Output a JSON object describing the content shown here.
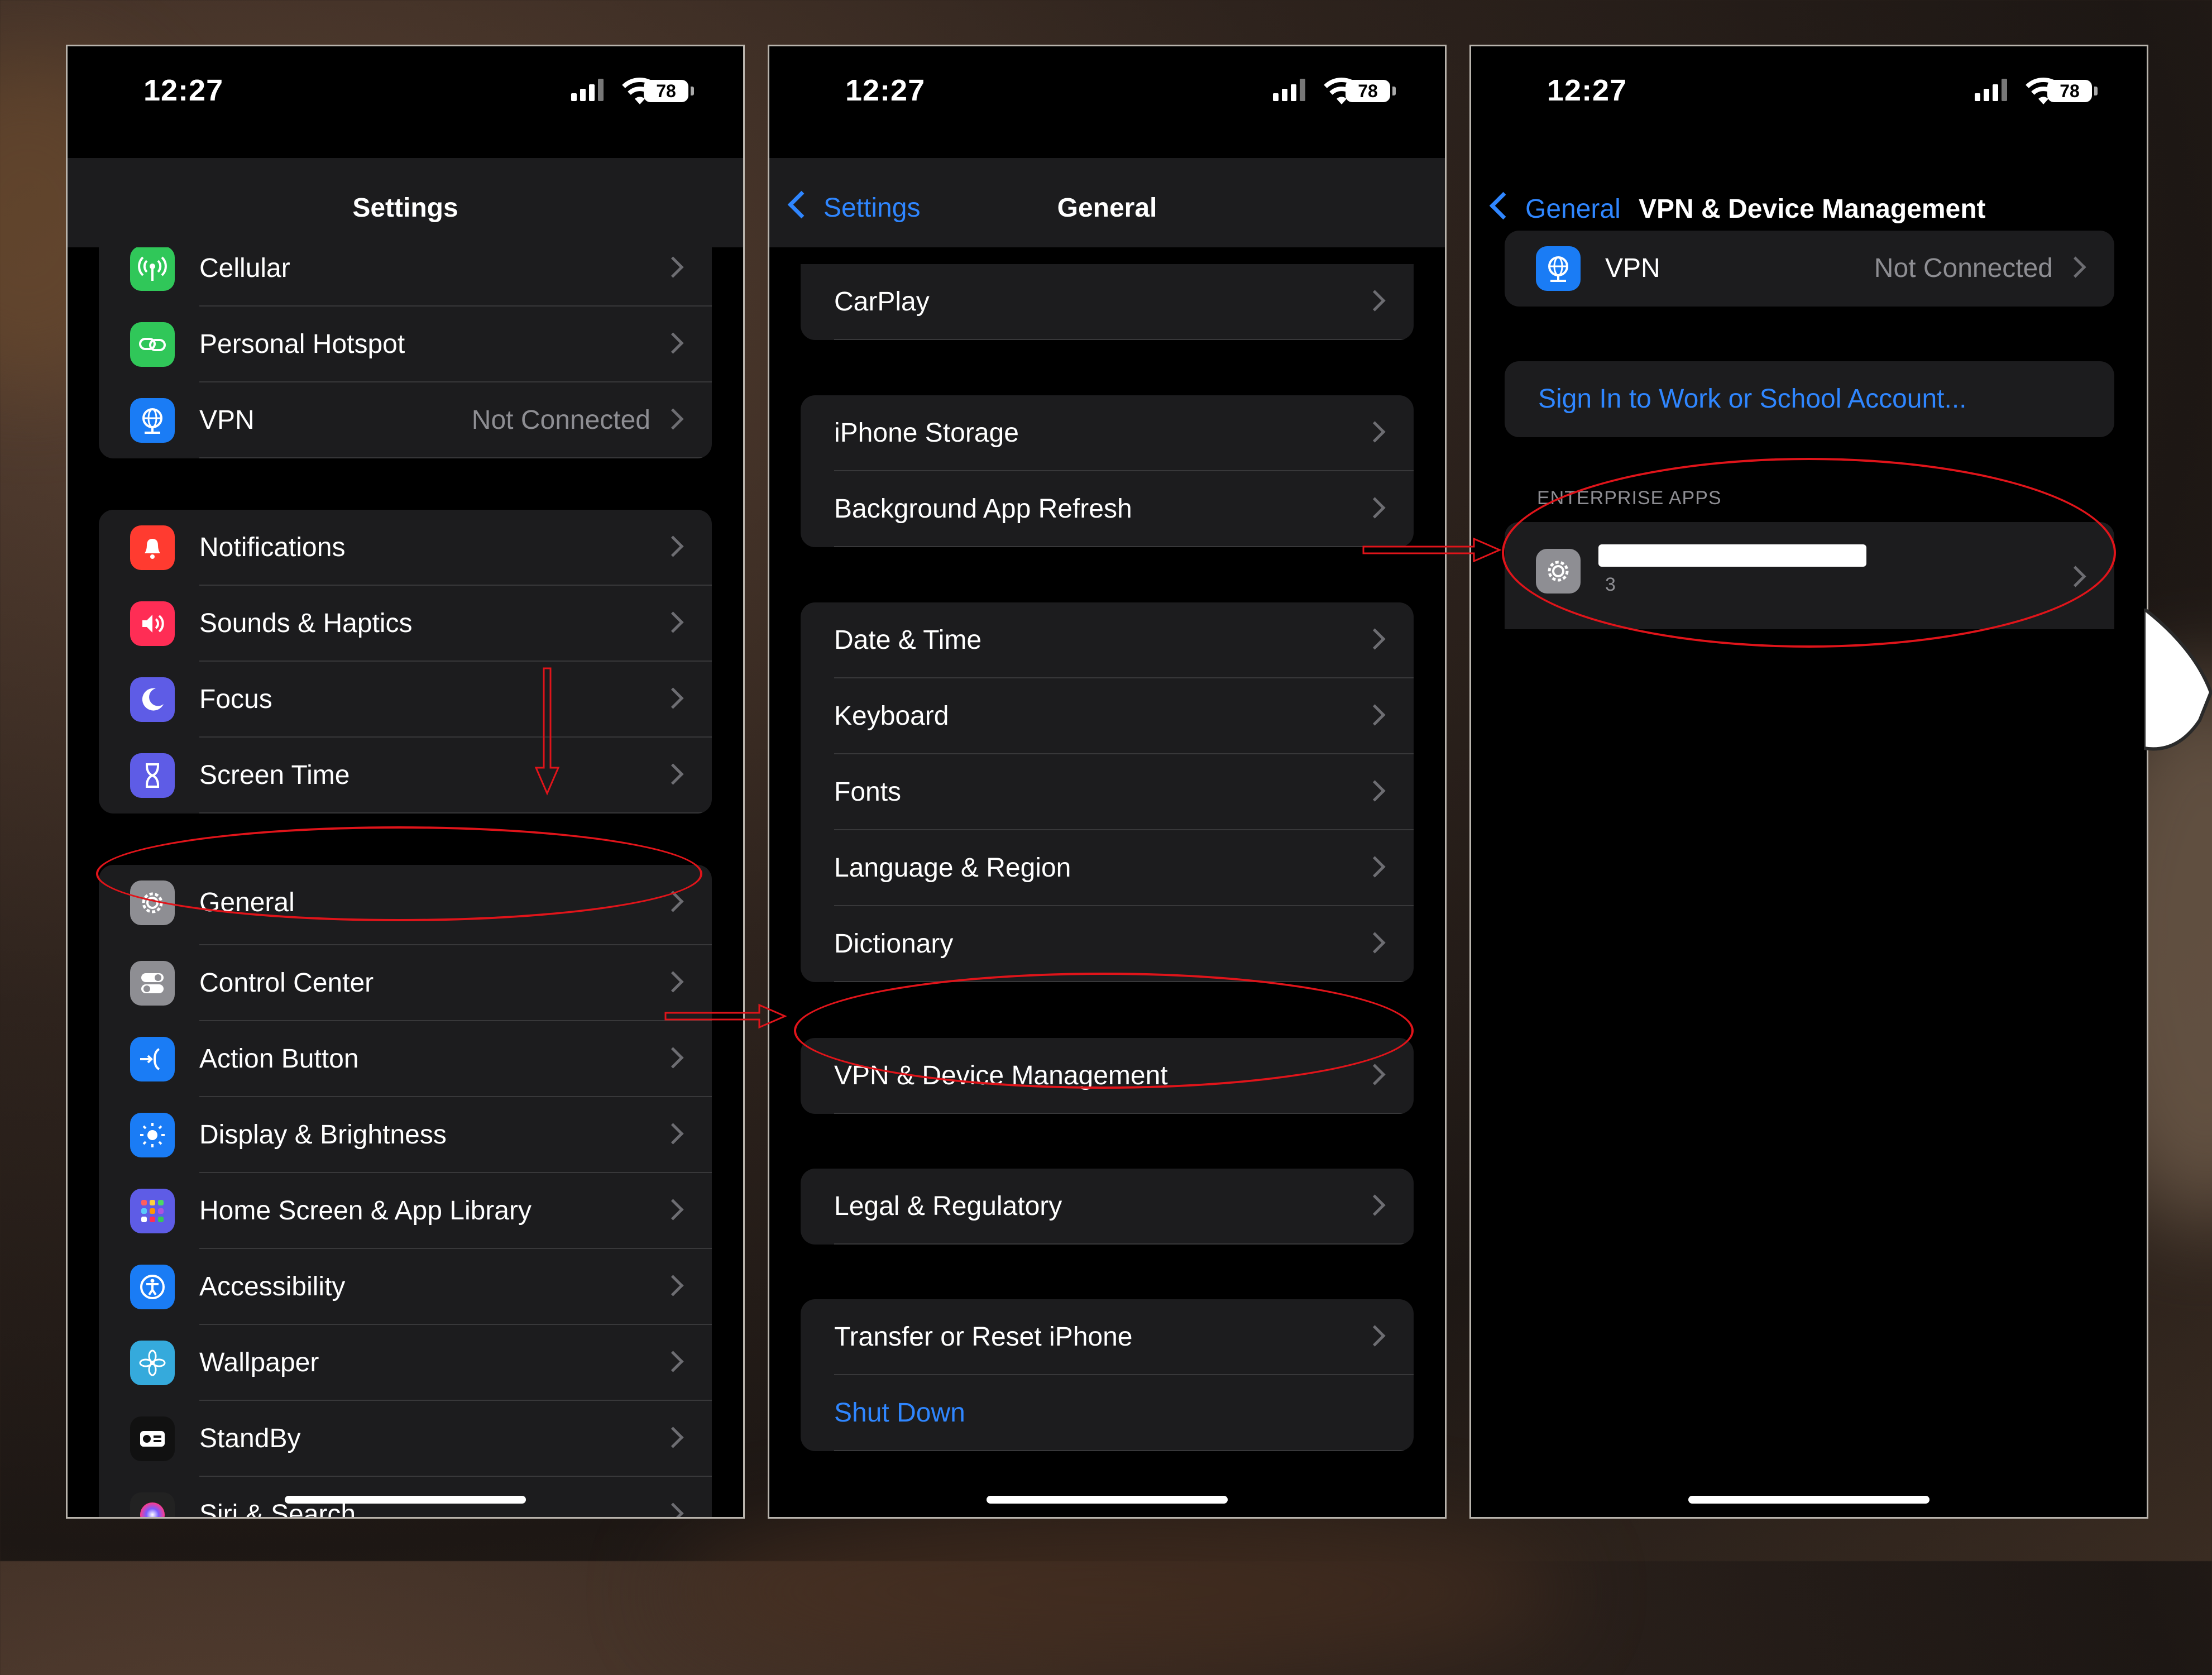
{
  "status": {
    "time": "12:27",
    "battery": "78"
  },
  "screen1": {
    "title": "Settings",
    "groups": [
      [
        {
          "label": "Cellular",
          "icon": "antenna-icon",
          "color": "#30c759"
        },
        {
          "label": "Personal Hotspot",
          "icon": "link-icon",
          "color": "#30c759"
        },
        {
          "label": "VPN",
          "icon": "globe-icon",
          "color": "#1a7cf5",
          "value": "Not Connected"
        }
      ],
      [
        {
          "label": "Notifications",
          "icon": "bell-icon",
          "color": "#ff3b30"
        },
        {
          "label": "Sounds & Haptics",
          "icon": "speaker-icon",
          "color": "#ff2d55"
        },
        {
          "label": "Focus",
          "icon": "moon-icon",
          "color": "#5e5ce6"
        },
        {
          "label": "Screen Time",
          "icon": "hourglass-icon",
          "color": "#5e5ce6"
        }
      ],
      [
        {
          "label": "General",
          "icon": "gear-icon",
          "color": "#8e8e93"
        },
        {
          "label": "Control Center",
          "icon": "toggles-icon",
          "color": "#8e8e93"
        },
        {
          "label": "Action Button",
          "icon": "action-icon",
          "color": "#1a7cf5"
        },
        {
          "label": "Display & Brightness",
          "icon": "sun-icon",
          "color": "#1a7cf5"
        },
        {
          "label": "Home Screen & App Library",
          "icon": "grid-icon",
          "color": "#5e5ce6"
        },
        {
          "label": "Accessibility",
          "icon": "accessibility-icon",
          "color": "#1a7cf5"
        },
        {
          "label": "Wallpaper",
          "icon": "flower-icon",
          "color": "#35aadc"
        },
        {
          "label": "StandBy",
          "icon": "standby-icon",
          "color": "#111111"
        },
        {
          "label": "Siri & Search",
          "icon": "siri-icon",
          "color": "#222222"
        }
      ]
    ]
  },
  "screen2": {
    "back": "Settings",
    "title": "General",
    "groups": [
      [
        {
          "label": "CarPlay"
        }
      ],
      [
        {
          "label": "iPhone Storage"
        },
        {
          "label": "Background App Refresh"
        }
      ],
      [
        {
          "label": "Date & Time"
        },
        {
          "label": "Keyboard"
        },
        {
          "label": "Fonts"
        },
        {
          "label": "Language & Region"
        },
        {
          "label": "Dictionary"
        }
      ],
      [
        {
          "label": "VPN & Device Management"
        }
      ],
      [
        {
          "label": "Legal & Regulatory"
        }
      ],
      [
        {
          "label": "Transfer or Reset iPhone"
        },
        {
          "label": "Shut Down",
          "blue": true
        }
      ]
    ]
  },
  "screen3": {
    "back": "General",
    "title": "VPN & Device Management",
    "vpn_label": "VPN",
    "vpn_value": "Not Connected",
    "sign_in": "Sign In to Work or School Account...",
    "section": "ENTERPRISE APPS",
    "app_sub": "3"
  },
  "colors": {
    "accent": "#2f86ff",
    "annotation": "#e0141a",
    "row_bg": "#1c1c1e"
  }
}
